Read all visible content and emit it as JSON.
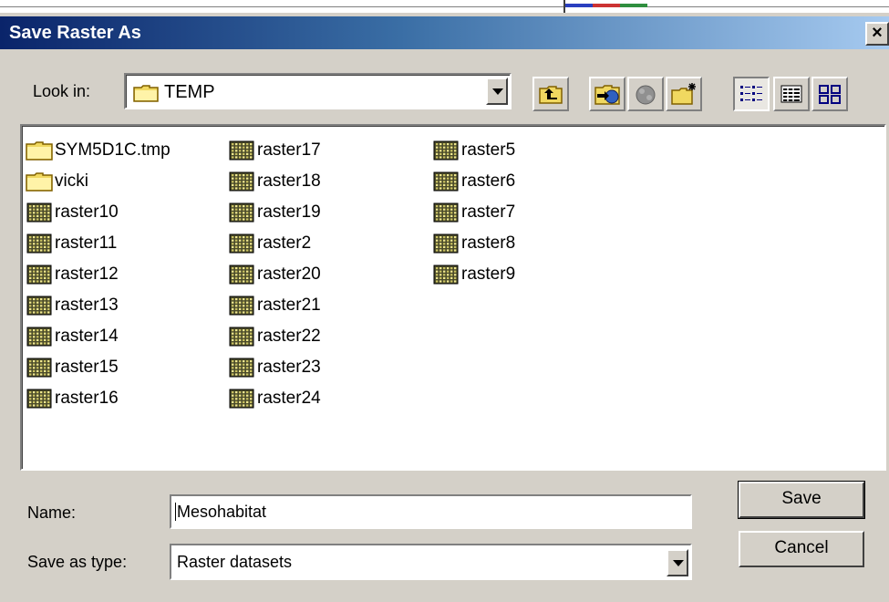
{
  "window": {
    "title": "Save Raster As",
    "close_glyph": "×"
  },
  "look_in": {
    "label": "Look in:",
    "value": "TEMP",
    "icon": "folder-icon"
  },
  "toolbar": {
    "buttons": [
      {
        "name": "up-one-level-button",
        "icon": "up-folder-arrow-icon"
      },
      {
        "name": "connect-folder-button",
        "icon": "connect-folder-icon"
      },
      {
        "name": "disconnect-folder-button",
        "icon": "disconnect-folder-icon"
      },
      {
        "name": "new-folder-button",
        "icon": "new-folder-icon"
      },
      {
        "name": "list-view-button",
        "icon": "list-view-icon",
        "pressed": true
      },
      {
        "name": "details-view-button",
        "icon": "details-view-icon"
      },
      {
        "name": "thumbnails-view-button",
        "icon": "thumbnails-view-icon"
      }
    ]
  },
  "files": {
    "columns": [
      [
        {
          "name": "SYM5D1C.tmp",
          "type": "folder"
        },
        {
          "name": "vicki",
          "type": "folder"
        },
        {
          "name": "raster10",
          "type": "raster"
        },
        {
          "name": "raster11",
          "type": "raster"
        },
        {
          "name": "raster12",
          "type": "raster"
        },
        {
          "name": "raster13",
          "type": "raster"
        },
        {
          "name": "raster14",
          "type": "raster"
        },
        {
          "name": "raster15",
          "type": "raster"
        },
        {
          "name": "raster16",
          "type": "raster"
        }
      ],
      [
        {
          "name": "raster17",
          "type": "raster"
        },
        {
          "name": "raster18",
          "type": "raster"
        },
        {
          "name": "raster19",
          "type": "raster"
        },
        {
          "name": "raster2",
          "type": "raster"
        },
        {
          "name": "raster20",
          "type": "raster"
        },
        {
          "name": "raster21",
          "type": "raster"
        },
        {
          "name": "raster22",
          "type": "raster"
        },
        {
          "name": "raster23",
          "type": "raster"
        },
        {
          "name": "raster24",
          "type": "raster"
        }
      ],
      [
        {
          "name": "raster5",
          "type": "raster"
        },
        {
          "name": "raster6",
          "type": "raster"
        },
        {
          "name": "raster7",
          "type": "raster"
        },
        {
          "name": "raster8",
          "type": "raster"
        },
        {
          "name": "raster9",
          "type": "raster"
        }
      ]
    ]
  },
  "form": {
    "name_label": "Name:",
    "name_value": "Mesohabitat",
    "type_label": "Save as type:",
    "type_value": "Raster datasets"
  },
  "actions": {
    "save_label": "Save",
    "cancel_label": "Cancel"
  },
  "colors": {
    "title_start": "#0a246a",
    "title_end": "#a6caf0",
    "face": "#d4d0c8"
  }
}
